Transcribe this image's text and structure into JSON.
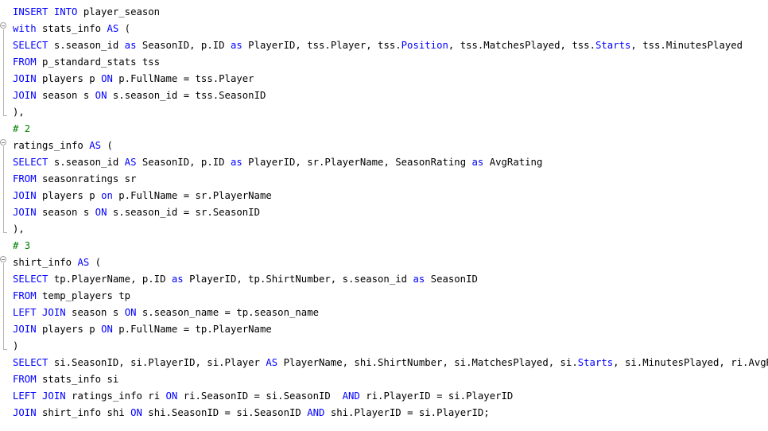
{
  "colors": {
    "keyword": "#0000ff",
    "comment": "#008000",
    "text": "#000000",
    "background": "#ffffff",
    "fold_guide": "#b4b4b4"
  },
  "icons": {
    "fold": "fold-collapse-icon"
  },
  "lines": [
    [
      [
        "k",
        "INSERT INTO"
      ],
      [
        "t",
        " player_season"
      ]
    ],
    [
      [
        "k",
        "with"
      ],
      [
        "t",
        " stats_info "
      ],
      [
        "k",
        "AS"
      ],
      [
        "t",
        " ("
      ]
    ],
    [
      [
        "k",
        "SELECT"
      ],
      [
        "t",
        " s.season_id "
      ],
      [
        "k",
        "as"
      ],
      [
        "t",
        " SeasonID, p.ID "
      ],
      [
        "k",
        "as"
      ],
      [
        "t",
        " PlayerID, tss.Player, tss."
      ],
      [
        "k",
        "Position"
      ],
      [
        "t",
        ", tss.MatchesPlayed, tss."
      ],
      [
        "k",
        "Starts"
      ],
      [
        "t",
        ", tss.MinutesPlayed"
      ]
    ],
    [
      [
        "k",
        "FROM"
      ],
      [
        "t",
        " p_standard_stats tss"
      ]
    ],
    [
      [
        "k",
        "JOIN"
      ],
      [
        "t",
        " players p "
      ],
      [
        "k",
        "ON"
      ],
      [
        "t",
        " p.FullName = tss.Player"
      ]
    ],
    [
      [
        "k",
        "JOIN"
      ],
      [
        "t",
        " season s "
      ],
      [
        "k",
        "ON"
      ],
      [
        "t",
        " s.season_id = tss.SeasonID"
      ]
    ],
    [
      [
        "t",
        "),"
      ]
    ],
    [
      [
        "c",
        "# 2"
      ]
    ],
    [
      [
        "t",
        "ratings_info "
      ],
      [
        "k",
        "AS"
      ],
      [
        "t",
        " ("
      ]
    ],
    [
      [
        "k",
        "SELECT"
      ],
      [
        "t",
        " s.season_id "
      ],
      [
        "k",
        "AS"
      ],
      [
        "t",
        " SeasonID, p.ID "
      ],
      [
        "k",
        "as"
      ],
      [
        "t",
        " PlayerID, sr.PlayerName, SeasonRating "
      ],
      [
        "k",
        "as"
      ],
      [
        "t",
        " AvgRating"
      ]
    ],
    [
      [
        "k",
        "FROM"
      ],
      [
        "t",
        " seasonratings sr"
      ]
    ],
    [
      [
        "k",
        "JOIN"
      ],
      [
        "t",
        " players p "
      ],
      [
        "k",
        "on"
      ],
      [
        "t",
        " p.FullName = sr.PlayerName"
      ]
    ],
    [
      [
        "k",
        "JOIN"
      ],
      [
        "t",
        " season s "
      ],
      [
        "k",
        "ON"
      ],
      [
        "t",
        " s.season_id = sr.SeasonID"
      ]
    ],
    [
      [
        "t",
        "),"
      ]
    ],
    [
      [
        "c",
        "# 3"
      ]
    ],
    [
      [
        "t",
        "shirt_info "
      ],
      [
        "k",
        "AS"
      ],
      [
        "t",
        " ("
      ]
    ],
    [
      [
        "k",
        "SELECT"
      ],
      [
        "t",
        " tp.PlayerName, p.ID "
      ],
      [
        "k",
        "as"
      ],
      [
        "t",
        " PlayerID, tp.ShirtNumber, s.season_id "
      ],
      [
        "k",
        "as"
      ],
      [
        "t",
        " SeasonID"
      ]
    ],
    [
      [
        "k",
        "FROM"
      ],
      [
        "t",
        " temp_players tp"
      ]
    ],
    [
      [
        "k",
        "LEFT JOIN"
      ],
      [
        "t",
        " season s "
      ],
      [
        "k",
        "ON"
      ],
      [
        "t",
        " s.season_name = tp.season_name"
      ]
    ],
    [
      [
        "k",
        "JOIN"
      ],
      [
        "t",
        " players p "
      ],
      [
        "k",
        "ON"
      ],
      [
        "t",
        " p.FullName = tp.PlayerName"
      ]
    ],
    [
      [
        "t",
        ")"
      ]
    ],
    [
      [
        "k",
        "SELECT"
      ],
      [
        "t",
        " si.SeasonID, si.PlayerID, si.Player "
      ],
      [
        "k",
        "AS"
      ],
      [
        "t",
        " PlayerName, shi.ShirtNumber, si.MatchesPlayed, si."
      ],
      [
        "k",
        "Starts"
      ],
      [
        "t",
        ", si.MinutesPlayed, ri.AvgRating"
      ]
    ],
    [
      [
        "k",
        "FROM"
      ],
      [
        "t",
        " stats_info si"
      ]
    ],
    [
      [
        "k",
        "LEFT JOIN"
      ],
      [
        "t",
        " ratings_info ri "
      ],
      [
        "k",
        "ON"
      ],
      [
        "t",
        " ri.SeasonID = si.SeasonID  "
      ],
      [
        "k",
        "AND"
      ],
      [
        "t",
        " ri.PlayerID = si.PlayerID"
      ]
    ],
    [
      [
        "k",
        "JOIN"
      ],
      [
        "t",
        " shirt_info shi "
      ],
      [
        "k",
        "ON"
      ],
      [
        "t",
        " shi.SeasonID = si.SeasonID "
      ],
      [
        "k",
        "AND"
      ],
      [
        "t",
        " shi.PlayerID = si.PlayerID;"
      ]
    ]
  ]
}
